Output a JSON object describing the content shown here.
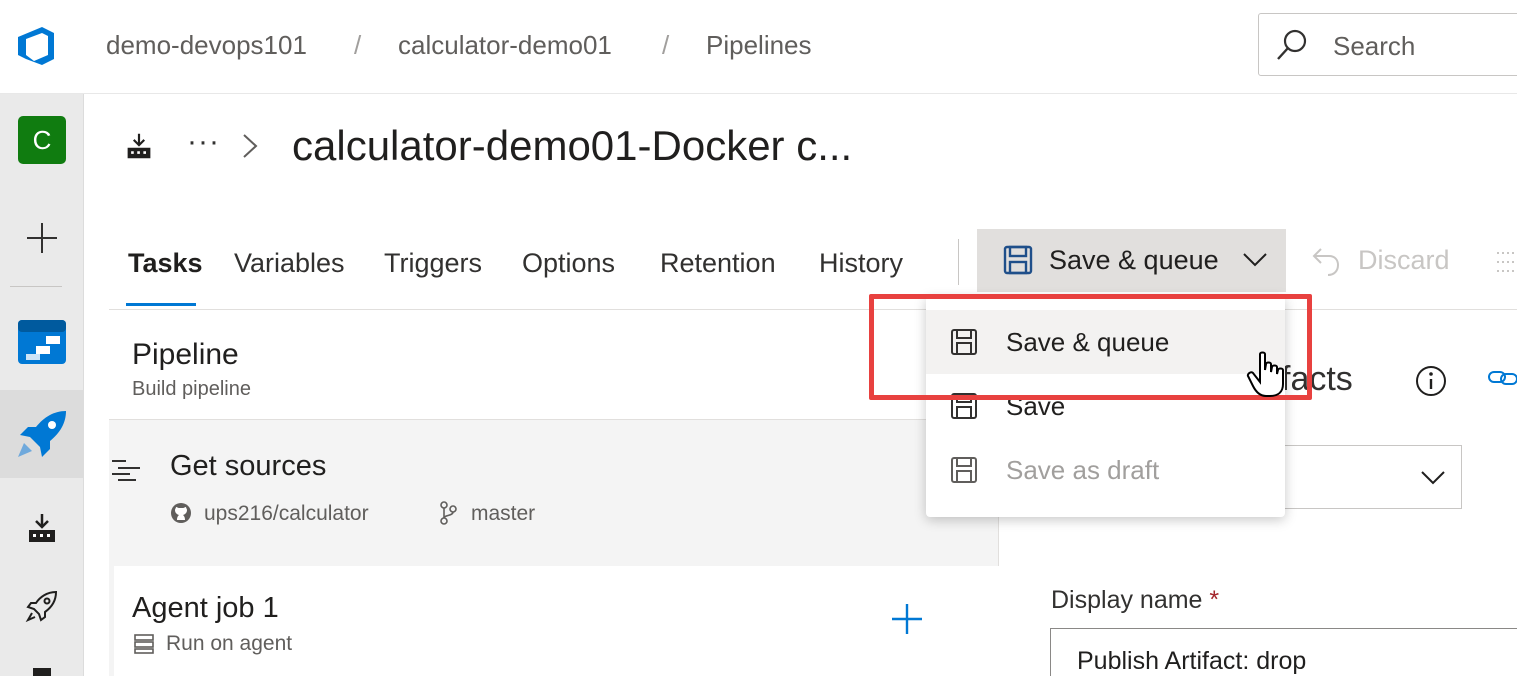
{
  "breadcrumb": {
    "org": "demo-devops101",
    "project": "calculator-demo01",
    "section": "Pipelines",
    "separator": "/"
  },
  "search": {
    "placeholder": "Search"
  },
  "rail": {
    "avatar_letter": "C"
  },
  "header": {
    "ellipsis": "···",
    "title": "calculator-demo01-Docker c..."
  },
  "tabs": [
    {
      "label": "Tasks",
      "active": true
    },
    {
      "label": "Variables"
    },
    {
      "label": "Triggers"
    },
    {
      "label": "Options"
    },
    {
      "label": "Retention"
    },
    {
      "label": "History"
    }
  ],
  "toolbar": {
    "save_queue_label": "Save & queue",
    "discard_label": "Discard"
  },
  "menu": {
    "items": [
      {
        "label": "Save & queue"
      },
      {
        "label": "Save"
      },
      {
        "label": "Save as draft",
        "disabled": true
      }
    ]
  },
  "pipeline": {
    "title": "Pipeline",
    "subtitle": "Build pipeline"
  },
  "sources": {
    "title": "Get sources",
    "repo": "ups216/calculator",
    "branch": "master"
  },
  "agent_job": {
    "title": "Agent job 1",
    "subtitle": "Run on agent"
  },
  "details": {
    "artifacts_title": "Artifacts",
    "display_name_label": "Display name",
    "required_mark": "*",
    "display_name_value": "Publish Artifact: drop"
  },
  "colors": {
    "accent": "#0078d4",
    "highlight": "#e8413f",
    "avatar": "#107c10"
  }
}
